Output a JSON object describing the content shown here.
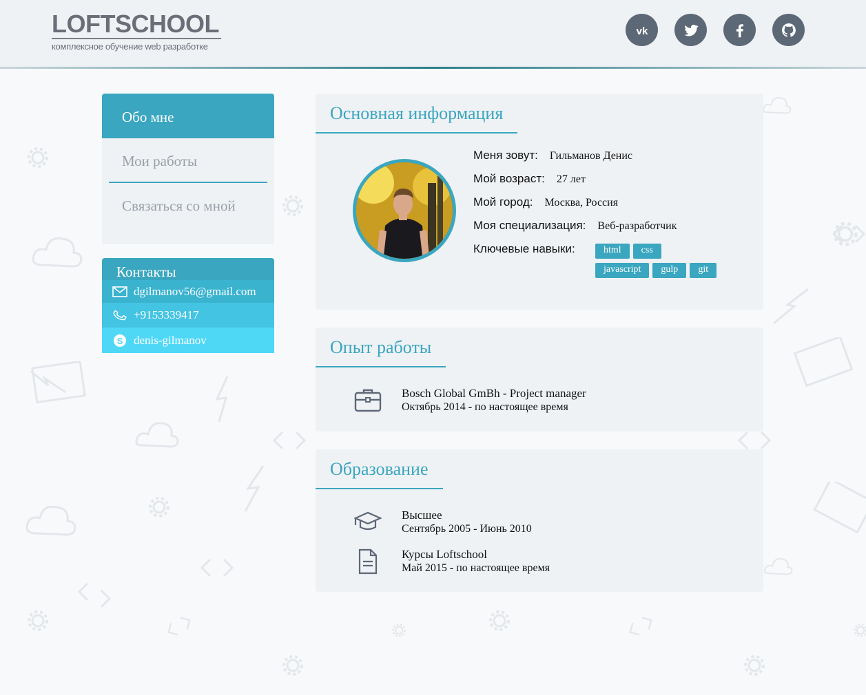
{
  "header": {
    "logo_title": "LOFTSCHOOL",
    "logo_subtitle": "комплексное обучение web разработке",
    "socials": [
      {
        "name": "vk-icon"
      },
      {
        "name": "twitter-icon"
      },
      {
        "name": "facebook-icon"
      },
      {
        "name": "github-icon"
      }
    ]
  },
  "nav": {
    "items": [
      {
        "label": "Обо мне",
        "active": true
      },
      {
        "label": "Мои работы",
        "active": false
      },
      {
        "label": "Связаться со мной",
        "active": false
      }
    ]
  },
  "contacts": {
    "title": "Контакты",
    "email": "dgilmanov56@gmail.com",
    "phone": "+9153339417",
    "skype": "denis-gilmanov"
  },
  "main_info": {
    "title": "Основная информация",
    "rows": [
      {
        "label": "Меня зовут:",
        "value": "Гильманов Денис"
      },
      {
        "label": "Мой возраст:",
        "value": "27 лет"
      },
      {
        "label": "Мой город:",
        "value": "Москва, Россия"
      },
      {
        "label": "Моя специализация:",
        "value": "Веб-разработчик"
      },
      {
        "label": "Ключевые навыки:",
        "value": ""
      }
    ],
    "skills": [
      "html",
      "css",
      "javascript",
      "gulp",
      "git"
    ]
  },
  "experience": {
    "title": "Опыт работы",
    "items": [
      {
        "title": "Bosch Global GmBh - Project manager",
        "period": "Октябрь 2014 - по настоящее время"
      }
    ]
  },
  "education": {
    "title": "Образование",
    "items": [
      {
        "title": "Высшее",
        "period": "Сентябрь 2005 - Июнь 2010"
      },
      {
        "title": "Курсы Loftschool",
        "period": "Май 2015 - по настоящее время"
      }
    ]
  },
  "colors": {
    "accent": "#3aa6bf",
    "panel": "#eff2f5",
    "social": "#5d6877"
  }
}
